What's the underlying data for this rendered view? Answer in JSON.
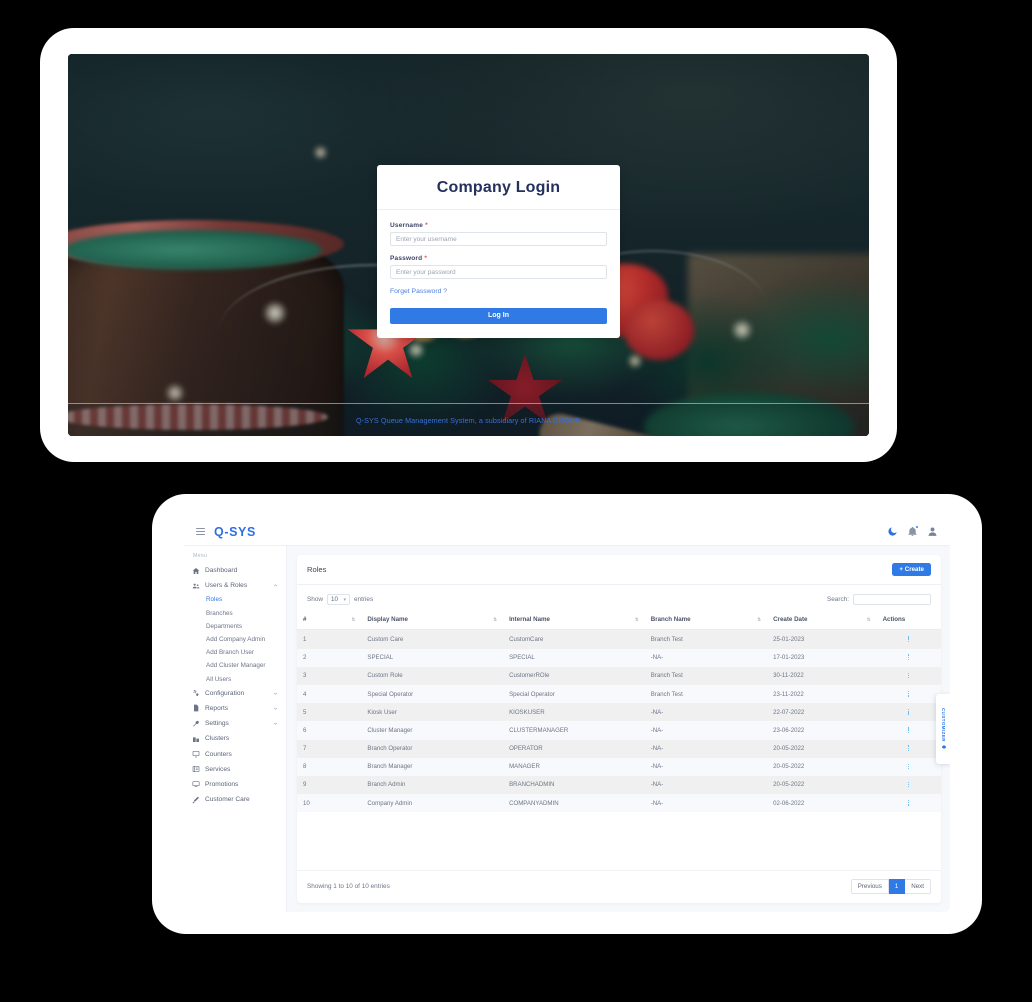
{
  "login": {
    "title": "Company Login",
    "username_label": "Username",
    "username_required": "*",
    "username_placeholder": "Enter your username",
    "password_label": "Password",
    "password_required": "*",
    "password_placeholder": "Enter your password",
    "forgot_label": "Forget Password ?",
    "submit_label": "Log In",
    "footer_text": "Q-SYS Queue Management System, a subsidiary of RIANA GROUP.",
    "accent_color": "#2f7ae5",
    "title_color": "#24305e",
    "link_color": "#4b7fe0",
    "background": "christmas-decorations-photo"
  },
  "dashboard": {
    "topbar": {
      "brand": "Q-SYS",
      "menu_icon": "hamburger-icon",
      "icons": [
        {
          "name": "dark-mode-icon",
          "glyph": "moon"
        },
        {
          "name": "notifications-icon",
          "glyph": "bell",
          "badge": true
        },
        {
          "name": "user-avatar-icon",
          "glyph": "user"
        }
      ]
    },
    "sidebar": {
      "caption": "Menu",
      "items": [
        {
          "label": "Dashboard",
          "icon": "home-icon",
          "expandable": false
        },
        {
          "label": "Users & Roles",
          "icon": "users-icon",
          "expandable": true,
          "expanded": true
        },
        {
          "label": "Configuration",
          "icon": "gears-icon",
          "expandable": true,
          "expanded": false
        },
        {
          "label": "Reports",
          "icon": "file-icon",
          "expandable": true,
          "expanded": false
        },
        {
          "label": "Settings",
          "icon": "wrench-icon",
          "expandable": true,
          "expanded": false
        },
        {
          "label": "Clusters",
          "icon": "building-icon",
          "expandable": false
        },
        {
          "label": "Counters",
          "icon": "monitor-icon",
          "expandable": false
        },
        {
          "label": "Services",
          "icon": "list-icon",
          "expandable": false
        },
        {
          "label": "Promotions",
          "icon": "tv-icon",
          "expandable": false
        },
        {
          "label": "Customer Care",
          "icon": "headset-icon",
          "expandable": false
        }
      ],
      "subitems": [
        {
          "label": "Roles",
          "active": true
        },
        {
          "label": "Branches",
          "active": false
        },
        {
          "label": "Departments",
          "active": false
        },
        {
          "label": "Add Company Admin",
          "active": false
        },
        {
          "label": "Add Branch User",
          "active": false
        },
        {
          "label": "Add Cluster Manager",
          "active": false
        },
        {
          "label": "All Users",
          "active": false
        }
      ]
    },
    "panel": {
      "title": "Roles",
      "create_label": "+ Create",
      "show_label": "Show",
      "entries_label": "entries",
      "page_size": "10",
      "search_label": "Search:",
      "search_value": "",
      "search_placeholder": "",
      "columns": [
        "#",
        "Display Name",
        "Internal Name",
        "Branch Name",
        "Create Date",
        "Actions"
      ],
      "rows": [
        {
          "num": "1",
          "display": "Custom Care",
          "internal": "CustomCare",
          "branch": "Branch Test",
          "date": "25-01-2023"
        },
        {
          "num": "2",
          "display": "SPECIAL",
          "internal": "SPECIAL",
          "branch": "-NA-",
          "date": "17-01-2023"
        },
        {
          "num": "3",
          "display": "Custom Role",
          "internal": "CustomerROle",
          "branch": "Branch Test",
          "date": "30-11-2022"
        },
        {
          "num": "4",
          "display": "Special Operator",
          "internal": "Special Operator",
          "branch": "Branch Test",
          "date": "23-11-2022"
        },
        {
          "num": "5",
          "display": "Kiosk User",
          "internal": "KIOSKUSER",
          "branch": "-NA-",
          "date": "22-07-2022"
        },
        {
          "num": "6",
          "display": "Cluster Manager",
          "internal": "CLUSTERMANAGER",
          "branch": "-NA-",
          "date": "23-06-2022"
        },
        {
          "num": "7",
          "display": "Branch Operator",
          "internal": "OPERATOR",
          "branch": "-NA-",
          "date": "20-05-2022"
        },
        {
          "num": "8",
          "display": "Branch Manager",
          "internal": "MANAGER",
          "branch": "-NA-",
          "date": "20-05-2022"
        },
        {
          "num": "9",
          "display": "Branch Admin",
          "internal": "BRANCHADMIN",
          "branch": "-NA-",
          "date": "20-05-2022"
        },
        {
          "num": "10",
          "display": "Company Admin",
          "internal": "COMPANYADMIN",
          "branch": "-NA-",
          "date": "02-06-2022"
        }
      ],
      "showing_text": "Showing 1 to 10 of 10 entries",
      "pagination": {
        "previous": "Previous",
        "current": "1",
        "next": "Next"
      }
    },
    "customizer": {
      "label": "CUSTOMIZER",
      "icon": "gear-icon"
    }
  }
}
